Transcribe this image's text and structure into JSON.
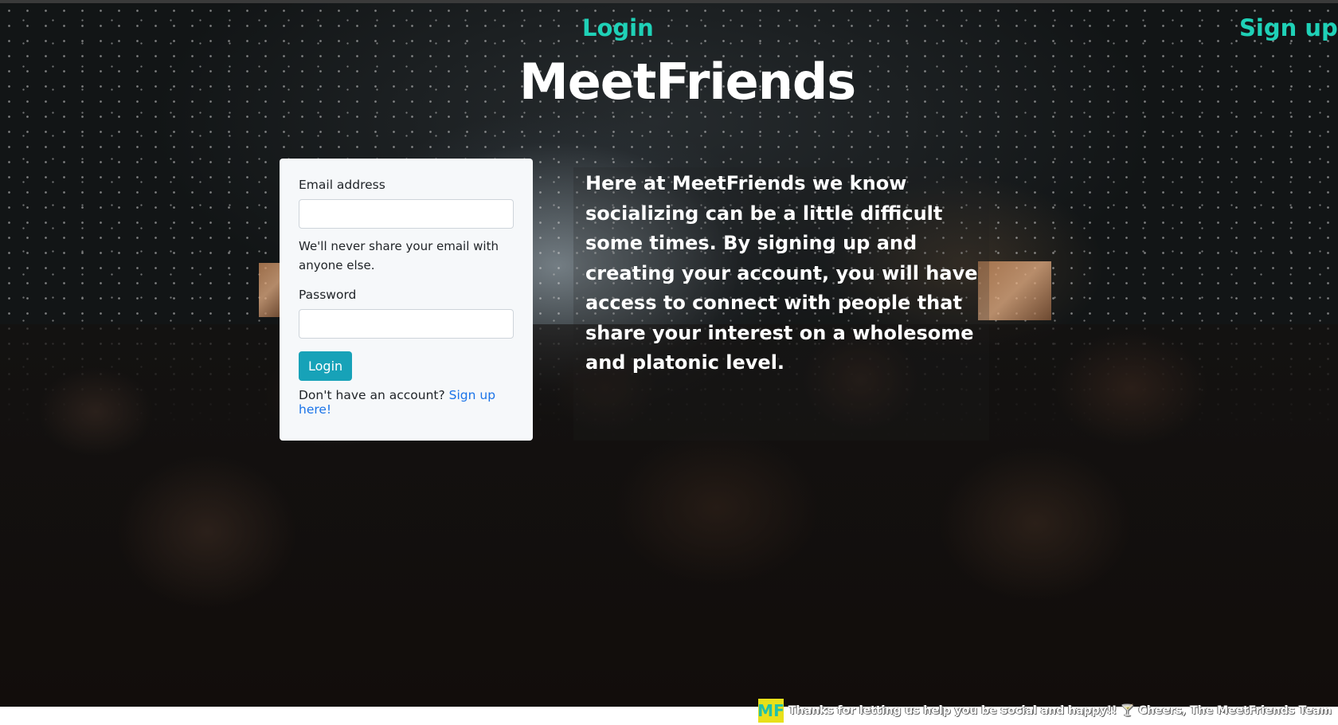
{
  "nav": {
    "login_label": "Login",
    "signup_label": "Sign up"
  },
  "brand": "MeetFriends",
  "login_form": {
    "email_label": "Email address",
    "email_value": "",
    "email_help": "We'll never share your email with anyone else.",
    "password_label": "Password",
    "password_value": "",
    "submit_label": "Login",
    "signup_prompt": "Don't have an account?",
    "signup_link": "Sign up here!"
  },
  "intro_text": "Here at MeetFriends we know socializing can be a little difficult some times. By signing up and creating your account, you will have access to connect with people that share your interest on a wholesome and platonic level.",
  "footer": {
    "logo_text": "MF",
    "message": "Thanks for letting us help you be social and happy!! 🍸 Cheers, The MeetFriends Team"
  },
  "colors": {
    "nav_accent": "#1fd1b7",
    "button": "#17a2b8",
    "link": "#1a73e8",
    "logo_bg": "#e8e01a"
  }
}
